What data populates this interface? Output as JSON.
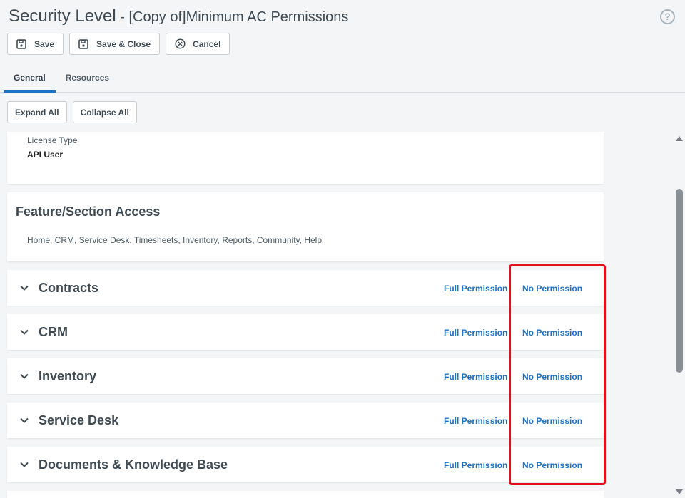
{
  "header": {
    "title": "Security Level",
    "subtitle": " - [Copy of]Minimum AC Permissions",
    "help": "?"
  },
  "toolbar": {
    "save_label": "Save",
    "save_close_label": "Save & Close",
    "cancel_label": "Cancel"
  },
  "tabs": [
    {
      "label": "General",
      "active": true
    },
    {
      "label": "Resources",
      "active": false
    }
  ],
  "actions": {
    "expand_all": "Expand All",
    "collapse_all": "Collapse All"
  },
  "license": {
    "label": "License Type",
    "value": "API User"
  },
  "feature_access": {
    "heading": "Feature/Section Access",
    "modules": "Home, CRM, Service Desk, Timesheets, Inventory, Reports, Community, Help"
  },
  "sections": [
    {
      "name": "Contracts",
      "full": "Full Permission",
      "none": "No Permission"
    },
    {
      "name": "CRM",
      "full": "Full Permission",
      "none": "No Permission"
    },
    {
      "name": "Inventory",
      "full": "Full Permission",
      "none": "No Permission"
    },
    {
      "name": "Service Desk",
      "full": "Full Permission",
      "none": "No Permission"
    },
    {
      "name": "Documents & Knowledge Base",
      "full": "Full Permission",
      "none": "No Permission"
    }
  ],
  "colors": {
    "accent": "#1a73c9",
    "highlight_border": "#e0101d",
    "page_bg": "#f4f5f7"
  }
}
